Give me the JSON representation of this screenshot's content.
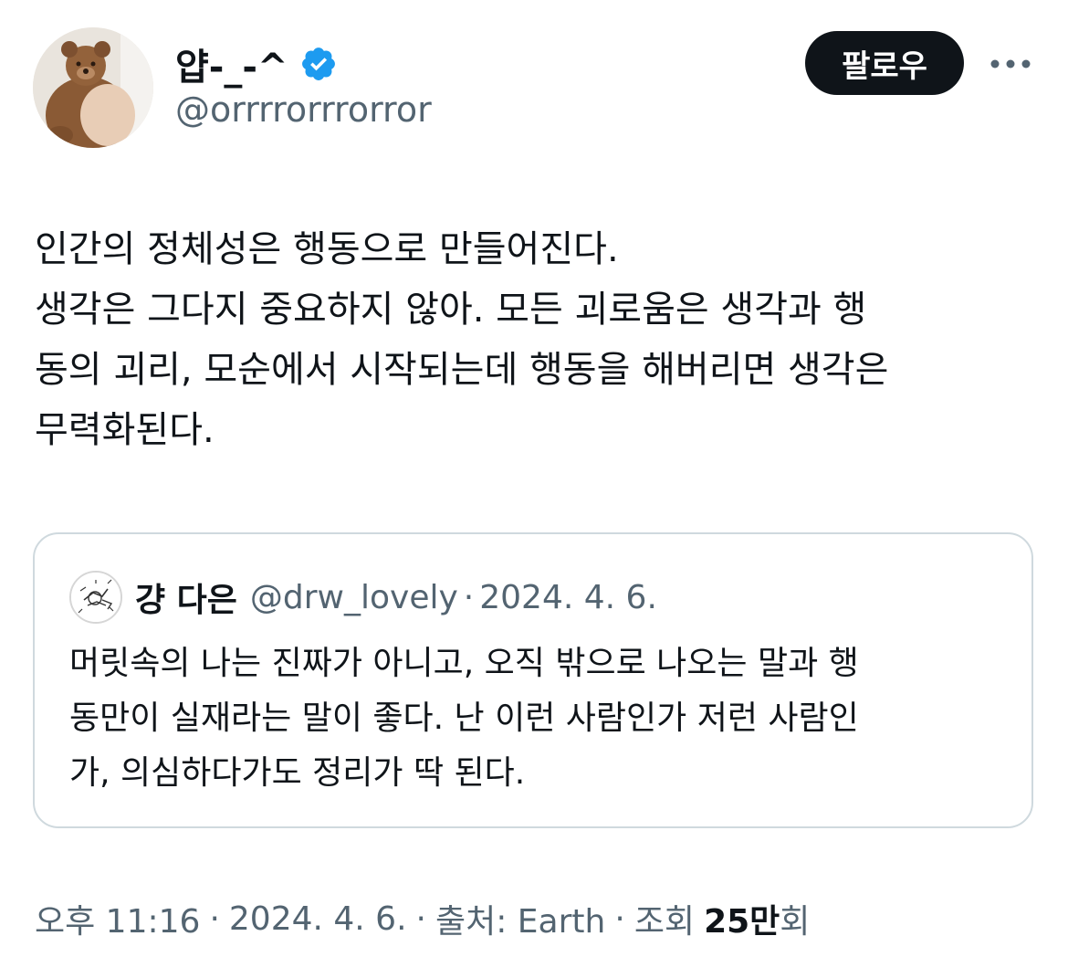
{
  "author": {
    "display_name": "얍-_-^",
    "handle": "@orrrrorrrorror",
    "verified": true,
    "avatar_icon": "teddy-bear-avatar-icon",
    "verified_icon": "verified-badge-icon"
  },
  "actions": {
    "follow_label": "팔로우",
    "more_icon": "more-options-icon"
  },
  "tweet": {
    "text": "인간의 정체성은 행동으로 만들어진다.\n생각은 그다지 중요하지 않아. 모든 괴로움은 생각과 행\n동의 괴리, 모순에서 시작되는데 행동을 해버리면 생각은\n무력화된다."
  },
  "quote": {
    "name": "걍 다은",
    "handle": "@drw_lovely",
    "separator": "·",
    "date": "2024. 4. 6.",
    "avatar_icon": "sketch-doodle-avatar-icon",
    "text": "머릿속의 나는 진짜가 아니고, 오직 밖으로 나오는 말과 행\n동만이 실재라는 말이 좋다. 난 이런 사람인가 저런 사람인\n가, 의심하다가도 정리가 딱 된다."
  },
  "meta": {
    "time": "오후 11:16",
    "separator": "·",
    "date": "2024. 4. 6.",
    "source": "출처: Earth",
    "views_label": "조회",
    "views_number": "25만",
    "views_suffix": "회"
  },
  "colors": {
    "primary_text": "#0f1419",
    "secondary_text": "#536471",
    "verified_blue": "#1d9bf0",
    "border": "#cfd9de",
    "follow_bg": "#0f1419"
  }
}
